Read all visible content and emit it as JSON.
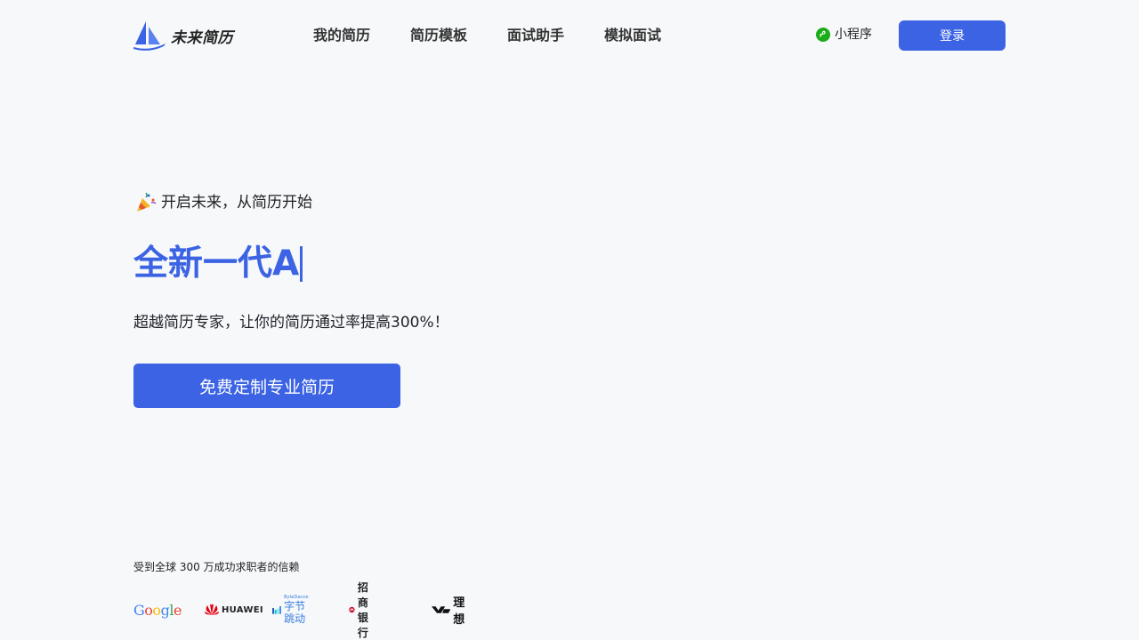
{
  "header": {
    "brand_name": "未来简历",
    "nav": [
      {
        "label": "我的简历"
      },
      {
        "label": "简历模板"
      },
      {
        "label": "面试助手"
      },
      {
        "label": "模拟面试"
      }
    ],
    "mini_program_label": "小程序",
    "login_label": "登录"
  },
  "hero": {
    "tagline": "开启未来，从简历开始",
    "title": "全新一代A",
    "subtitle": "超越简历专家，让你的简历通过率提高300%！",
    "cta_label": "免费定制专业简历"
  },
  "trust": {
    "text": "受到全球 300 万成功求职者的信赖",
    "brands": {
      "google": "Google",
      "huawei": "HUAWEI",
      "bytedance_en": "ByteDance",
      "bytedance_cn": "字节跳动",
      "cmb": "招商银行",
      "lixiang": "理想"
    }
  },
  "colors": {
    "accent": "#3b63e3",
    "background": "#f6f8fa",
    "wechat_green": "#1aad19",
    "huawei_red": "#e60012",
    "cmb_red": "#c8102e"
  },
  "icons": [
    "sailboat-logo-icon",
    "wechat-mini-program-icon",
    "party-popper-icon",
    "google-logo",
    "huawei-logo-icon",
    "bytedance-logo-icon",
    "cmb-logo-icon",
    "lixiang-logo-icon"
  ]
}
